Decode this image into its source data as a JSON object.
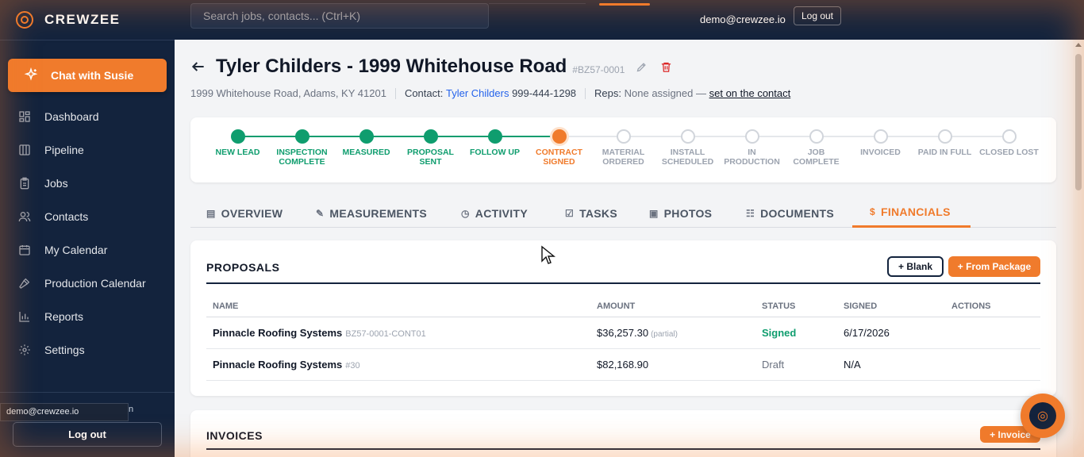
{
  "brand": {
    "name": "CREWZEE"
  },
  "sidebar": {
    "chat_label": "Chat with Susie",
    "items": [
      {
        "label": "Dashboard",
        "icon": "dashboard-icon"
      },
      {
        "label": "Pipeline",
        "icon": "pipeline-icon"
      },
      {
        "label": "Jobs",
        "icon": "clipboard-icon"
      },
      {
        "label": "Contacts",
        "icon": "users-icon"
      },
      {
        "label": "My Calendar",
        "icon": "calendar-icon"
      },
      {
        "label": "Production Calendar",
        "icon": "hammer-icon"
      },
      {
        "label": "Reports",
        "icon": "bar-chart-icon"
      },
      {
        "label": "Settings",
        "icon": "gear-icon"
      }
    ],
    "user_tooltip": "demo@crewzee.io",
    "user_tooltip_tail": "n",
    "logout_label": "Log out"
  },
  "topbar": {
    "search_placeholder": "Search jobs, contacts... (Ctrl+K)",
    "email": "demo@crewzee.io",
    "logout_label": "Log out"
  },
  "job": {
    "title": "Tyler Childers - 1999 Whitehouse Road",
    "code": "#BZ57-0001",
    "address": "1999 Whitehouse Road, Adams, KY 41201",
    "contact_label": "Contact:",
    "contact_name": "Tyler Childers",
    "contact_phone": "999-444-1298",
    "reps_label": "Reps:",
    "reps_value": "None assigned —",
    "reps_link": "set on the contact"
  },
  "stages": [
    {
      "line1": "NEW LEAD",
      "line2": "",
      "state": "done"
    },
    {
      "line1": "INSPECTION",
      "line2": "COMPLETE",
      "state": "done"
    },
    {
      "line1": "MEASURED",
      "line2": "",
      "state": "done"
    },
    {
      "line1": "PROPOSAL",
      "line2": "SENT",
      "state": "done"
    },
    {
      "line1": "FOLLOW UP",
      "line2": "",
      "state": "done"
    },
    {
      "line1": "CONTRACT",
      "line2": "SIGNED",
      "state": "current"
    },
    {
      "line1": "MATERIAL",
      "line2": "ORDERED",
      "state": "todo"
    },
    {
      "line1": "INSTALL",
      "line2": "SCHEDULED",
      "state": "todo"
    },
    {
      "line1": "IN",
      "line2": "PRODUCTION",
      "state": "todo"
    },
    {
      "line1": "JOB",
      "line2": "COMPLETE",
      "state": "todo"
    },
    {
      "line1": "INVOICED",
      "line2": "",
      "state": "todo"
    },
    {
      "line1": "PAID IN FULL",
      "line2": "",
      "state": "todo"
    },
    {
      "line1": "CLOSED LOST",
      "line2": "",
      "state": "todo"
    }
  ],
  "tabs": [
    {
      "label": "OVERVIEW",
      "icon": "grid-icon",
      "active": false
    },
    {
      "label": "MEASUREMENTS",
      "icon": "ruler-icon",
      "active": false
    },
    {
      "label": "ACTIVITY",
      "icon": "clock-icon",
      "active": false
    },
    {
      "label": "TASKS",
      "icon": "checkbox-icon",
      "active": false
    },
    {
      "label": "PHOTOS",
      "icon": "camera-icon",
      "active": false
    },
    {
      "label": "DOCUMENTS",
      "icon": "document-icon",
      "active": false
    },
    {
      "label": "FINANCIALS",
      "icon": "dollar-icon",
      "active": true
    }
  ],
  "proposals": {
    "title": "PROPOSALS",
    "blank_label": "+ Blank",
    "package_label": "+ From Package",
    "columns": [
      "NAME",
      "AMOUNT",
      "STATUS",
      "SIGNED",
      "ACTIONS"
    ],
    "rows": [
      {
        "name": "Pinnacle Roofing Systems",
        "ref": "BZ57-0001-CONT01",
        "amount": "$36,257.30",
        "amount_note": "(partial)",
        "status": "Signed",
        "signed": "6/17/2026"
      },
      {
        "name": "Pinnacle Roofing Systems",
        "ref": "#30",
        "amount": "$82,168.90",
        "amount_note": "",
        "status": "Draft",
        "signed": "N/A"
      }
    ]
  },
  "invoices": {
    "title": "INVOICES",
    "add_label": "+ Invoice"
  },
  "colors": {
    "accent": "#f07b2c",
    "navy": "#13233d",
    "success": "#0f9d6e"
  }
}
